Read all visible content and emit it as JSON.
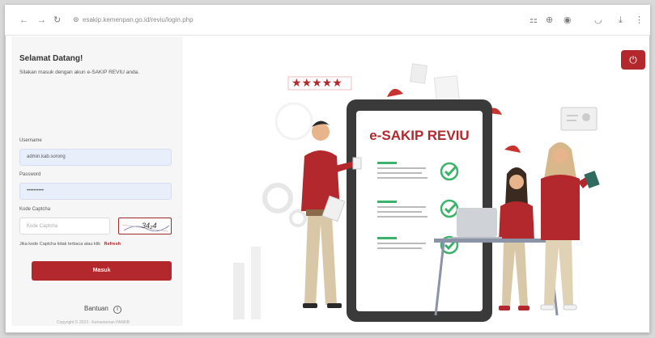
{
  "browser": {
    "url": "esakip.kemenpan.go.id/reviu/login.php",
    "nav_back": "←",
    "nav_forward": "→",
    "nav_refresh": "↻"
  },
  "login": {
    "title": "Selamat Datang!",
    "subtitle": "Silakan masuk dengan akun e-SAKIP REVIU anda.",
    "username_label": "Username",
    "username_value": "admin.kab.sorong",
    "password_label": "Password",
    "password_value": "••••••••••",
    "captcha_label": "Kode Captcha",
    "captcha_placeholder": "Kode Captcha",
    "captcha_text": "34₂4",
    "refresh_hint": "Jika kode Captcha tidak terbaca atau klik",
    "refresh_link": "Refresh",
    "login_button": "Masuk",
    "help_label": "Bantuan",
    "footer": "Copyright © 2023 - Kementerian PANRB"
  },
  "hero": {
    "board_title": "e-SAKIP REVIU",
    "rating": "★★★★★",
    "corner_icon": "power-icon"
  },
  "colors": {
    "accent": "#b3282d",
    "field_bg": "#e8effb",
    "board": "#3a3a3a"
  }
}
